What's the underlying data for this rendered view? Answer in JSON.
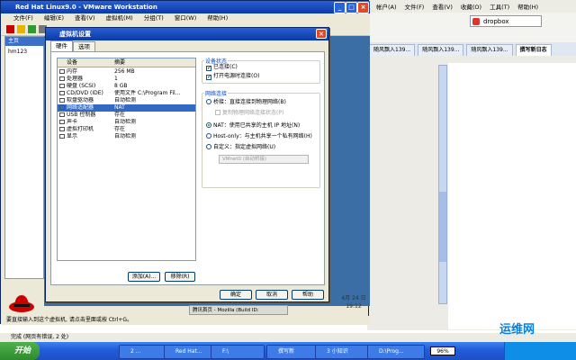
{
  "browser": {
    "menu": [
      "帐户(A)",
      "文件(F)",
      "查看(V)",
      "收藏(O)",
      "工具(T)",
      "帮助(H)"
    ],
    "search_placeholder": "dropbox",
    "tabs": [
      "随风飘入139...",
      "随风飘入139...",
      "随风飘入139...",
      "撰写新日志"
    ],
    "status": "完成 (网页有错误, 2 处)"
  },
  "vmware": {
    "title": "Red Hat Linux9.0 - VMware Workstation",
    "menu": [
      "文件(F)",
      "编辑(E)",
      "查看(V)",
      "虚拟机(M)",
      "分组(T)",
      "窗口(W)",
      "帮助(H)"
    ],
    "sidebar_tab": "主页",
    "sidebar_item": "hm123",
    "statusbar": "要直接输入到这个虚拟机, 请点击里面或按 Ctrl+G。"
  },
  "dialog": {
    "title": "虚拟机设置",
    "tabs": [
      "硬件",
      "选项"
    ],
    "columns": [
      "设备",
      "摘要"
    ],
    "devices": [
      {
        "name": "内存",
        "summary": "256 MB"
      },
      {
        "name": "处理器",
        "summary": "1"
      },
      {
        "name": "硬盘 (SCSI)",
        "summary": "8 GB"
      },
      {
        "name": "CD/DVD (IDE)",
        "summary": "使用文件 C:\\Program Fil..."
      },
      {
        "name": "软盘驱动器",
        "summary": "自动检测"
      },
      {
        "name": "网络适配器",
        "summary": "NAT"
      },
      {
        "name": "USB 控制器",
        "summary": "存在"
      },
      {
        "name": "声卡",
        "summary": "自动检测"
      },
      {
        "name": "虚拟打印机",
        "summary": "存在"
      },
      {
        "name": "显示",
        "summary": "自动检测"
      }
    ],
    "selected_index": 5,
    "add_button": "添加(A)...",
    "remove_button": "移除(R)",
    "device_status": {
      "label": "设备状态",
      "connected": "已连接(C)",
      "connect_at_power_on": "打开电源时连接(O)"
    },
    "network": {
      "label": "网络连接",
      "bridged": "桥接：直接连接到物理网络(B)",
      "replicate": "复制物理网络连接状态(P)",
      "nat": "NAT：使用已共享的主机 IP 地址(N)",
      "host_only": "Host-only：与主机共享一个私有网络(H)",
      "custom": "自定义：指定虚拟网络(U)",
      "custom_value": "VMnet0 (自动桥接)",
      "selected": "nat"
    },
    "ok_button": "确定",
    "cancel_button": "取消",
    "help_button": "帮助"
  },
  "taskbar": {
    "start": "开始",
    "items": [
      "2 ...",
      "Red Hat...",
      "F:\\",
      "撰写新",
      "3 小知识",
      "D:\\Prog..."
    ],
    "inner_item": "腾讯首页 - Mozilla (Build ID:",
    "battery": "96%",
    "clock_date": "4月 24 日",
    "clock_time": "19:12"
  },
  "watermark": "运维网",
  "colors": {
    "titlebar": "#0a3aa8",
    "selection": "#316ac5",
    "desktop": "#3a6ea5"
  }
}
